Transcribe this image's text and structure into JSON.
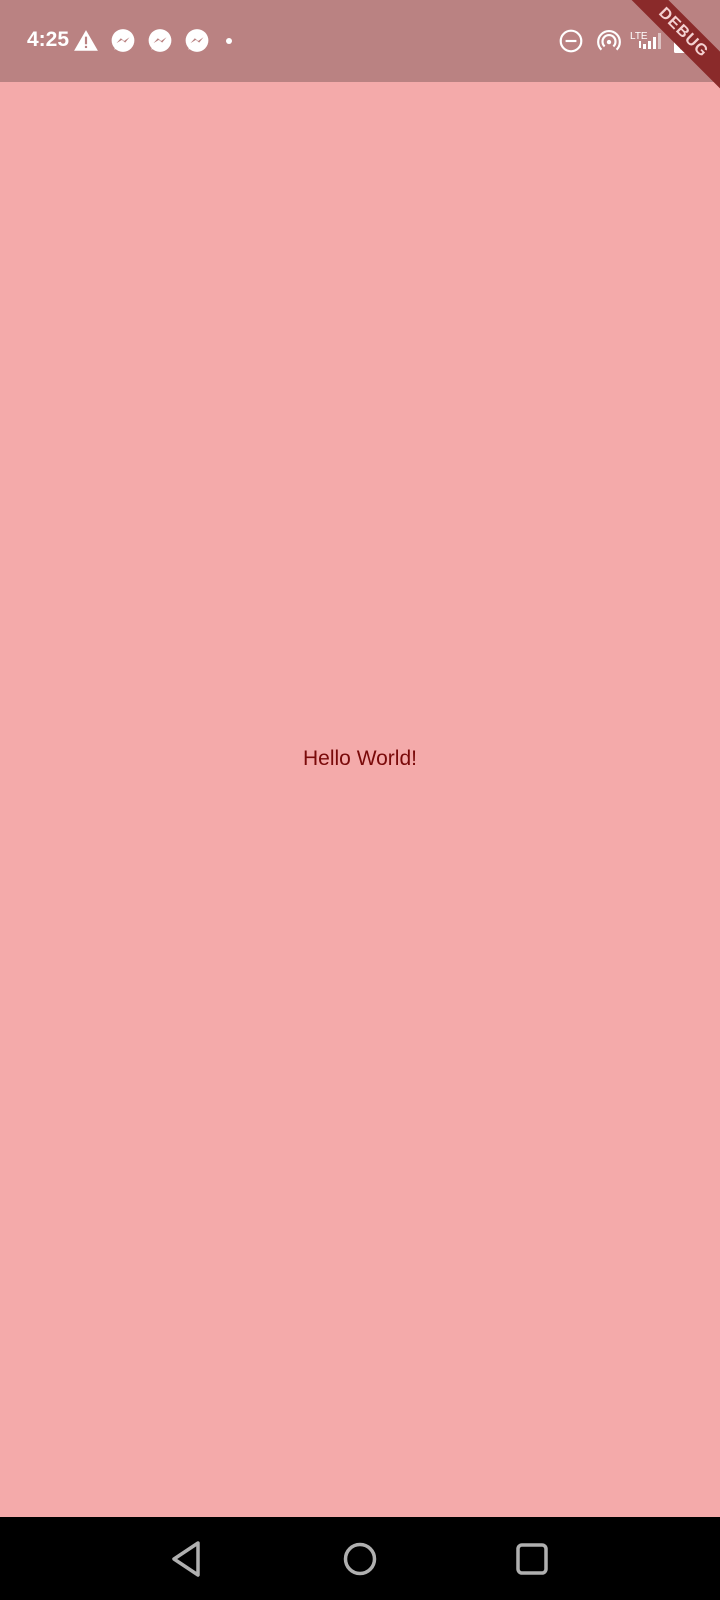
{
  "status_bar": {
    "time": "4:25",
    "icons": [
      "warning-icon",
      "messenger-icon",
      "messenger-icon",
      "messenger-icon",
      "notification-dot-icon",
      "do-not-disturb-icon",
      "hotspot-icon",
      "lte-signal-icon",
      "battery-charging-icon"
    ],
    "network_label": "LTE"
  },
  "debug_banner": {
    "label": "DEBUG"
  },
  "main": {
    "text": "Hello World!"
  },
  "nav_bar": {
    "buttons": [
      "back-icon",
      "home-icon",
      "recents-icon"
    ]
  },
  "colors": {
    "background": "#f4aaaa",
    "status_bar": "#ba8282",
    "text": "#7a0a0a",
    "nav_bar": "#000000"
  }
}
